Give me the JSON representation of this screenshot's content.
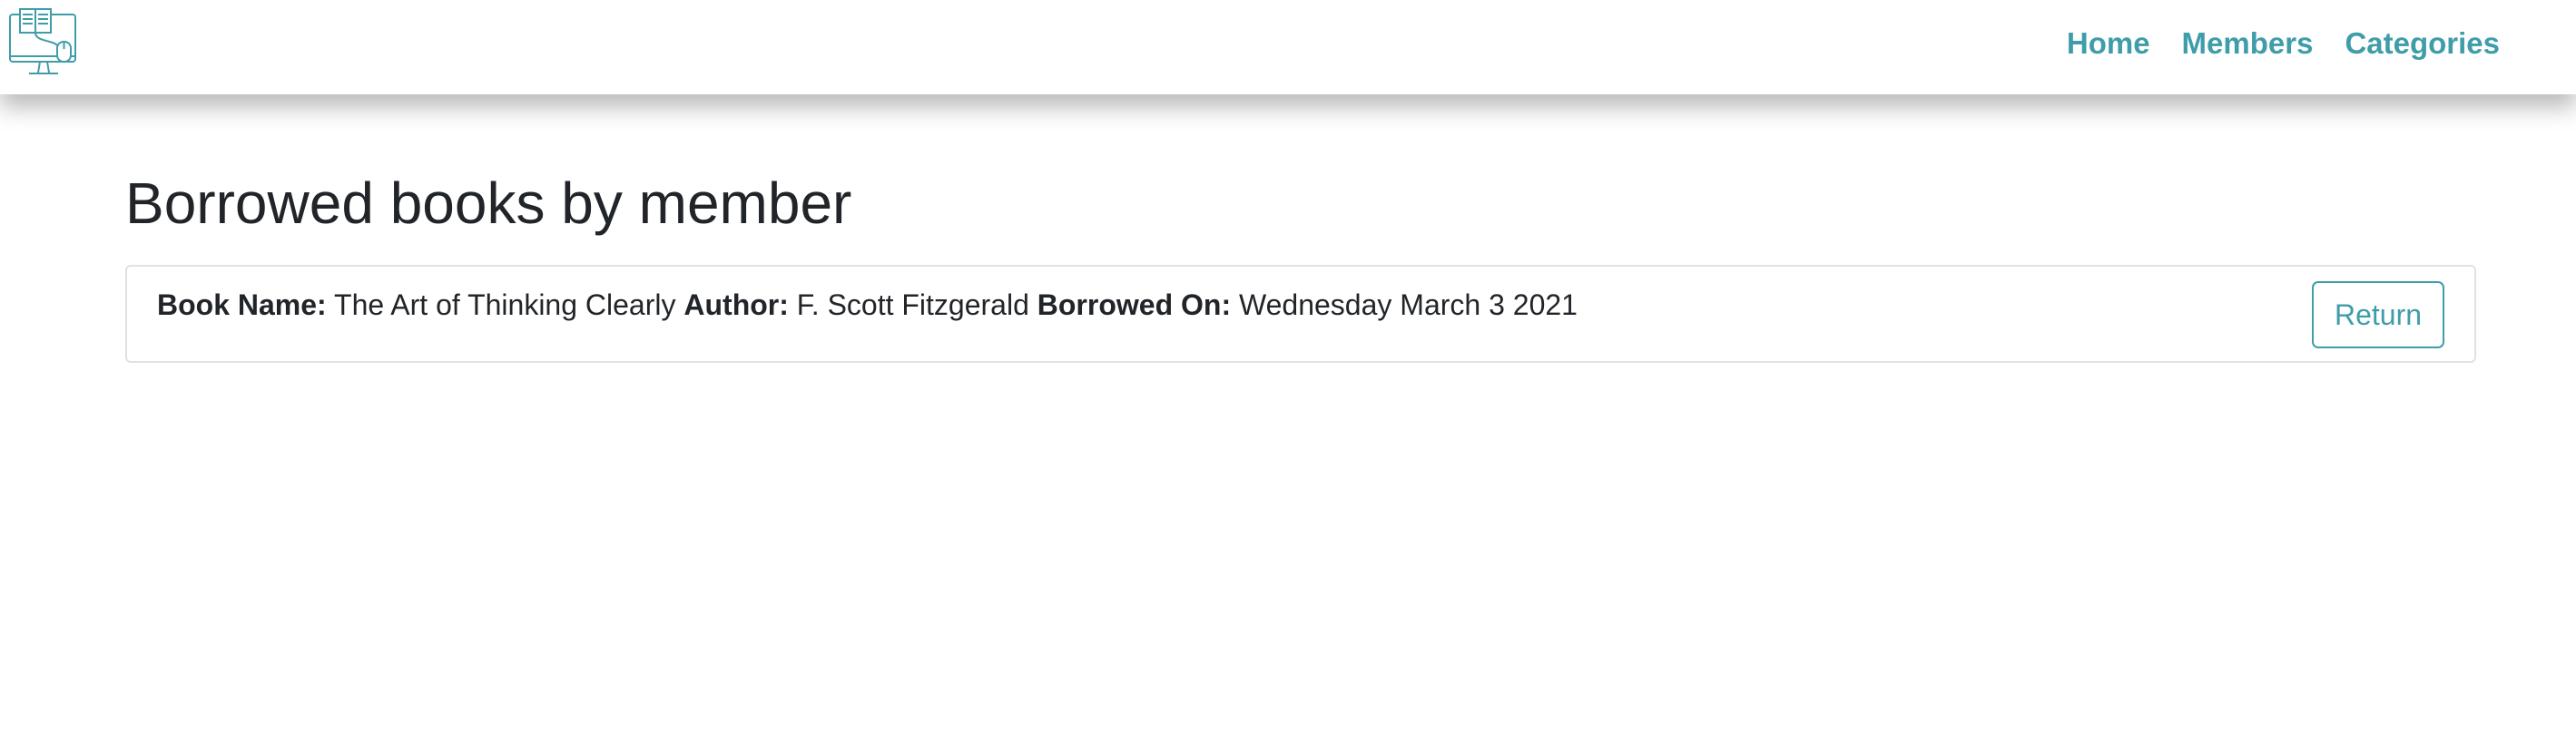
{
  "navbar": {
    "logo_icon": "computer-library-icon",
    "links": [
      {
        "label": "Home"
      },
      {
        "label": "Members"
      },
      {
        "label": "Categories"
      }
    ],
    "link_color": "#3f9da9"
  },
  "page": {
    "title": "Borrowed books by member"
  },
  "borrowed": [
    {
      "book_name_label": "Book Name:",
      "book_name": "The Art of Thinking Clearly",
      "author_label": "Author:",
      "author": "F. Scott Fitzgerald",
      "borrowed_on_label": "Borrowed On:",
      "borrowed_on": "Wednesday March 3 2021",
      "action_label": "Return"
    }
  ]
}
